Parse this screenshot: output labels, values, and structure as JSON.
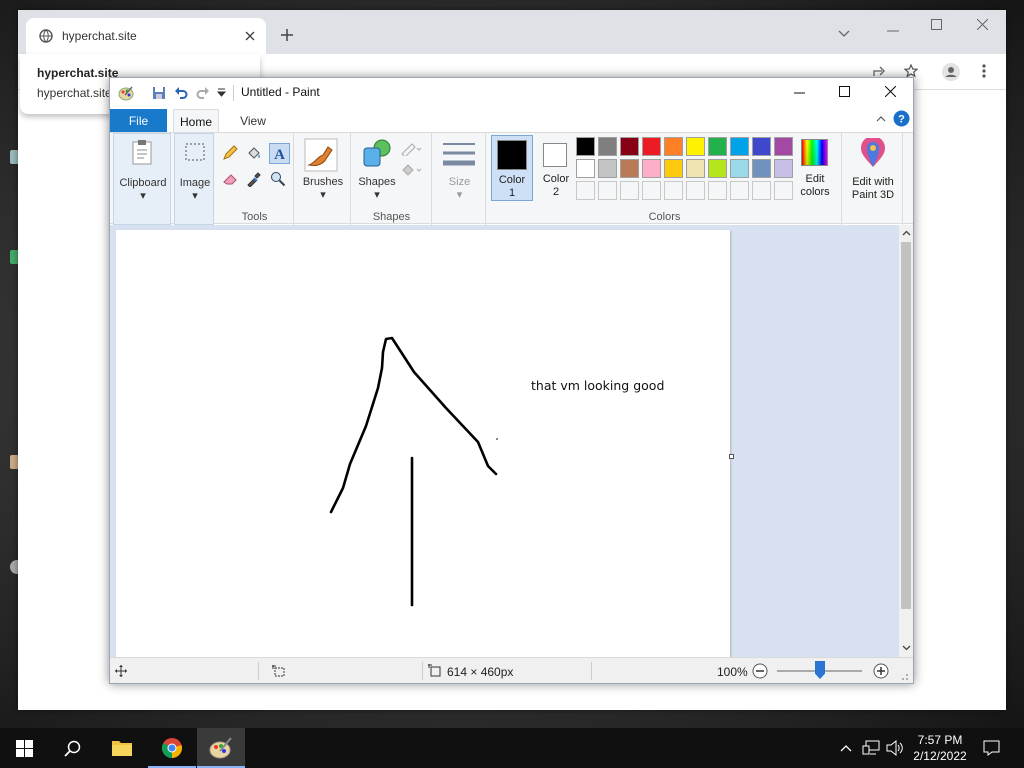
{
  "browser": {
    "tab_title": "hyperchat.site",
    "suggestion_title": "hyperchat.site",
    "suggestion_url": "hyperchat.site"
  },
  "paint": {
    "window_title": "Untitled - Paint",
    "tabs": {
      "file": "File",
      "home": "Home",
      "view": "View"
    },
    "ribbon": {
      "clipboard": "Clipboard",
      "image": "Image",
      "tools_group": "Tools",
      "brushes": "Brushes",
      "shapes_btn": "Shapes",
      "shapes_group": "Shapes",
      "size": "Size",
      "color1": "Color",
      "color1_num": "1",
      "color2": "Color",
      "color2_num": "2",
      "edit_colors_1": "Edit",
      "edit_colors_2": "colors",
      "colors_group": "Colors",
      "paint3d_1": "Edit with",
      "paint3d_2": "Paint 3D"
    },
    "palette_row1": [
      "#000000",
      "#7f7f7f",
      "#880015",
      "#ed1c24",
      "#ff7f27",
      "#fff200",
      "#22b14c",
      "#00a2e8",
      "#3f48cc",
      "#a349a4"
    ],
    "palette_row2": [
      "#ffffff",
      "#c3c3c3",
      "#b97a57",
      "#ffaec9",
      "#ffc90e",
      "#efe4b0",
      "#b5e61d",
      "#99d9ea",
      "#7092be",
      "#c8bfe7"
    ],
    "color1_value": "#000000",
    "color2_value": "#ffffff",
    "canvas_text": "that vm looking good",
    "status": {
      "dimensions": "614 × 460px",
      "zoom": "100%"
    }
  },
  "taskbar": {
    "time": "7:57 PM",
    "date": "2/12/2022"
  }
}
